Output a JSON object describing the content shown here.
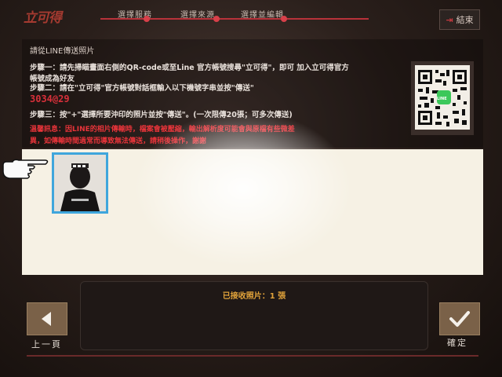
{
  "header": {
    "logo_text": "立可得",
    "steps": [
      "選擇服務",
      "選擇來源",
      "選擇並編輯"
    ],
    "exit_label": "結束",
    "exit_icon": "exit-arrow-icon"
  },
  "instructions": {
    "title": "請從LINE傳送照片",
    "step1_line1": "步驟一：請先掃瞄畫面右側的QR-code或至Line 官方帳號搜尋\"立可得\"，即可 加入立可得官方",
    "step1_line2": "帳號成為好友",
    "step2": "步驟二：請在\"立可得\"官方帳號對話框輸入以下機號字串並按\"傳送\"",
    "code": "3034@29",
    "step3": "步驟三：按\"+\"選擇所要沖印的照片並按\"傳送\"。(一次限傳20張；可多次傳送)",
    "notice_line1": "溫馨訊息：因LINE的相片傳輸時，檔案會被壓縮，輸出解析度可能會與原檔有些微差",
    "notice_line2": "異，如傳輸時間過常而導致無法傳送，請稍後操作，謝謝",
    "qr_badge": "LINE"
  },
  "photo_area": {
    "thumb_icon": "photo-thumbnail"
  },
  "status": {
    "received_label": "已接收照片：1 張"
  },
  "nav": {
    "prev_label": "上一頁",
    "confirm_label": "確定"
  },
  "colors": {
    "accent_red": "#d8303a",
    "selection_blue": "#3fa6dc",
    "status_orange": "#e0a23a",
    "button_brown": "#7a6148"
  }
}
